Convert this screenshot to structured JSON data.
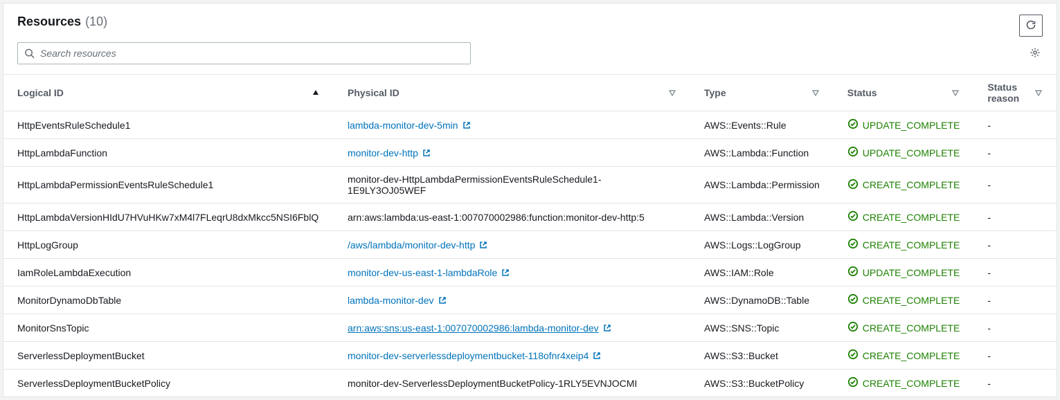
{
  "panel": {
    "title": "Resources",
    "count_label": "(10)"
  },
  "search": {
    "placeholder": "Search resources",
    "value": ""
  },
  "columns": {
    "logical_id": "Logical ID",
    "physical_id": "Physical ID",
    "type": "Type",
    "status": "Status",
    "status_reason": "Status reason"
  },
  "statuses": {
    "create_complete": "CREATE_COMPLETE",
    "update_complete": "UPDATE_COMPLETE"
  },
  "rows": [
    {
      "logical_id": "HttpEventsRuleSchedule1",
      "physical_id": "lambda-monitor-dev-5min",
      "physical_link": true,
      "type": "AWS::Events::Rule",
      "status": "UPDATE_COMPLETE",
      "status_reason": "-"
    },
    {
      "logical_id": "HttpLambdaFunction",
      "physical_id": "monitor-dev-http",
      "physical_link": true,
      "type": "AWS::Lambda::Function",
      "status": "UPDATE_COMPLETE",
      "status_reason": "-"
    },
    {
      "logical_id": "HttpLambdaPermissionEventsRuleSchedule1",
      "physical_id": "monitor-dev-HttpLambdaPermissionEventsRuleSchedule1-1E9LY3OJ05WEF",
      "physical_link": false,
      "type": "AWS::Lambda::Permission",
      "status": "CREATE_COMPLETE",
      "status_reason": "-"
    },
    {
      "logical_id": "HttpLambdaVersionHIdU7HVuHKw7xM4l7FLeqrU8dxMkcc5NSI6FblQ",
      "physical_id": "arn:aws:lambda:us-east-1:007070002986:function:monitor-dev-http:5",
      "physical_link": false,
      "type": "AWS::Lambda::Version",
      "status": "CREATE_COMPLETE",
      "status_reason": "-"
    },
    {
      "logical_id": "HttpLogGroup",
      "physical_id": "/aws/lambda/monitor-dev-http",
      "physical_link": true,
      "type": "AWS::Logs::LogGroup",
      "status": "CREATE_COMPLETE",
      "status_reason": "-"
    },
    {
      "logical_id": "IamRoleLambdaExecution",
      "physical_id": "monitor-dev-us-east-1-lambdaRole",
      "physical_link": true,
      "type": "AWS::IAM::Role",
      "status": "UPDATE_COMPLETE",
      "status_reason": "-"
    },
    {
      "logical_id": "MonitorDynamoDbTable",
      "physical_id": "lambda-monitor-dev",
      "physical_link": true,
      "type": "AWS::DynamoDB::Table",
      "status": "CREATE_COMPLETE",
      "status_reason": "-"
    },
    {
      "logical_id": "MonitorSnsTopic",
      "physical_id": "arn:aws:sns:us-east-1:007070002986:lambda-monitor-dev",
      "physical_link": true,
      "underlined": true,
      "type": "AWS::SNS::Topic",
      "status": "CREATE_COMPLETE",
      "status_reason": "-"
    },
    {
      "logical_id": "ServerlessDeploymentBucket",
      "physical_id": "monitor-dev-serverlessdeploymentbucket-118ofnr4xeip4",
      "physical_link": true,
      "type": "AWS::S3::Bucket",
      "status": "CREATE_COMPLETE",
      "status_reason": "-"
    },
    {
      "logical_id": "ServerlessDeploymentBucketPolicy",
      "physical_id": "monitor-dev-ServerlessDeploymentBucketPolicy-1RLY5EVNJOCMI",
      "physical_link": false,
      "type": "AWS::S3::BucketPolicy",
      "status": "CREATE_COMPLETE",
      "status_reason": "-"
    }
  ]
}
